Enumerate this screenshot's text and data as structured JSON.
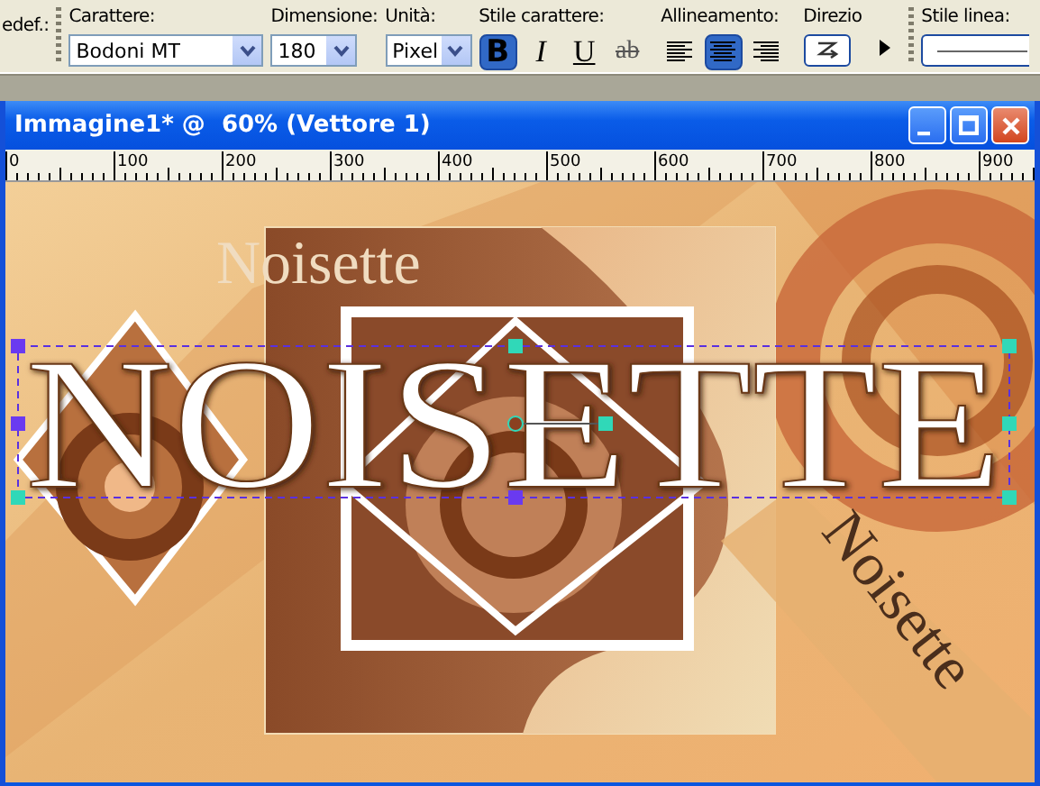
{
  "toolbar": {
    "preset_label": "edef.:",
    "fields": [
      {
        "label": "Carattere:",
        "value": "Bodoni MT"
      },
      {
        "label": "Dimensione:",
        "value": "180"
      },
      {
        "label": "Unità:",
        "value": "Pixel"
      }
    ],
    "style": {
      "label": "Stile carattere:",
      "buttons": [
        {
          "kind": "bold",
          "text": "B",
          "selected": true
        },
        {
          "kind": "italic",
          "text": "I",
          "selected": false
        },
        {
          "kind": "underline",
          "text": "U",
          "selected": false
        },
        {
          "kind": "strike",
          "text": "ab",
          "selected": false
        }
      ]
    },
    "alignment": {
      "label": "Allineamento:",
      "buttons": [
        {
          "kind": "left",
          "selected": false
        },
        {
          "kind": "center",
          "selected": true
        },
        {
          "kind": "right",
          "selected": false
        }
      ]
    },
    "direction": {
      "label": "Direzio"
    },
    "line_style": {
      "label": "Stile linea:"
    }
  },
  "window": {
    "title": "Immagine1* @  60% (Vettore 1)"
  },
  "ruler": {
    "labels": [
      "0",
      "100",
      "200",
      "300",
      "400",
      "500",
      "600",
      "700",
      "800",
      "900"
    ]
  },
  "canvas": {
    "headline": "NOISETTE",
    "art_texts": [
      "Noisette",
      "Noisette"
    ]
  }
}
